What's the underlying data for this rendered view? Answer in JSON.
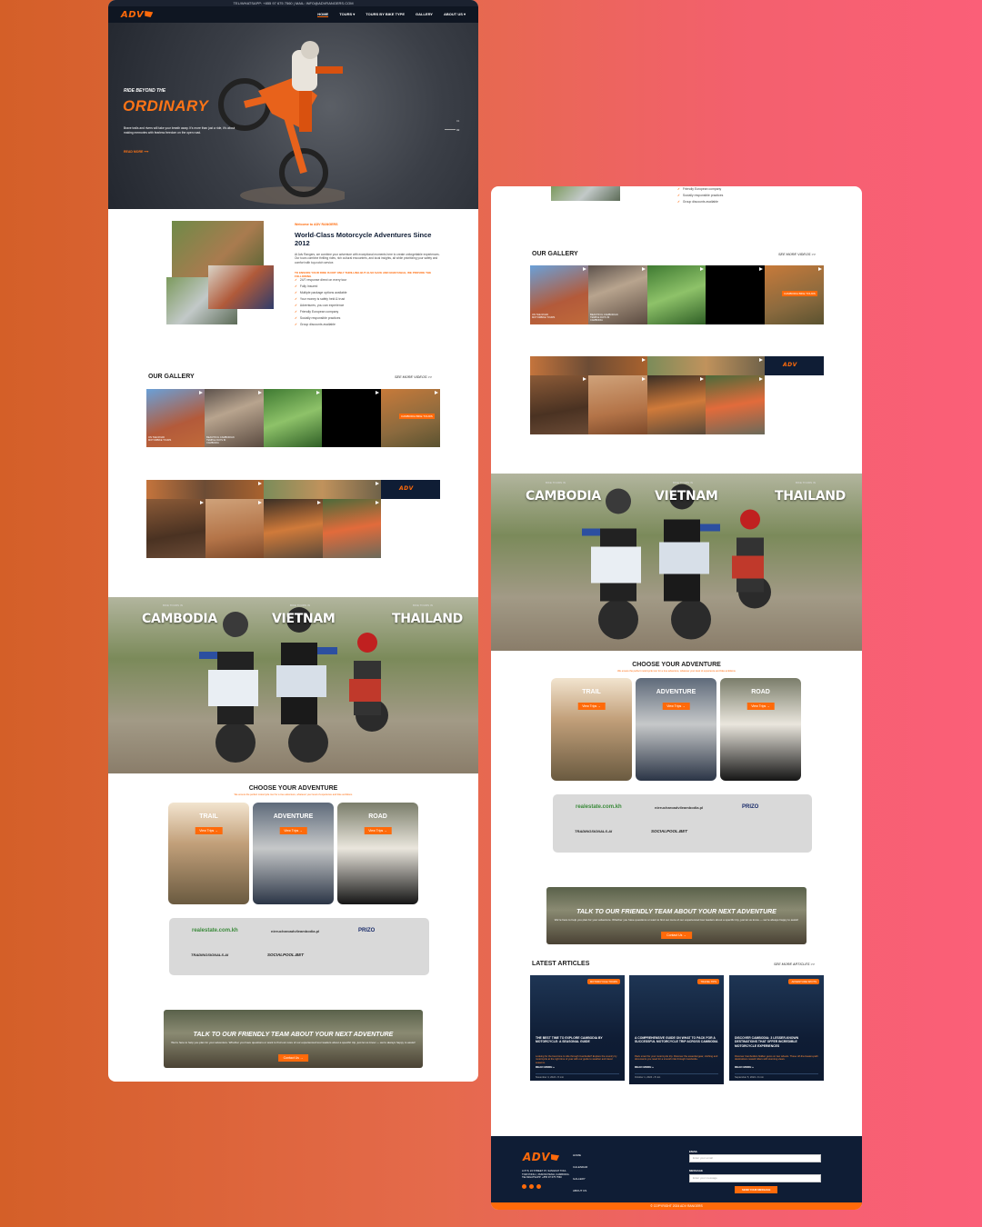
{
  "topbar": {
    "contact": "TEL/WHATSAPP: +855 97 675 7560 | MAIL: INFO@ADVRANGERS.COM"
  },
  "nav": {
    "logo": "ADV",
    "links": [
      "HOME",
      "TOURS ▾",
      "TOURS BY BIKE TYPE",
      "GALLERY",
      "ABOUT US ▾"
    ]
  },
  "hero": {
    "kicker": "RIDE BEYOND THE",
    "title": "ORDINARY",
    "body": "Brave trails and rivers will take your breath away. It's more than just a ride, it's about making memories with fearless freedom on the open road.",
    "button": "READ MORE",
    "social": [
      "FACEBOOK",
      "INSTAGRAM",
      "YOUTUBE"
    ],
    "slider": [
      "01",
      "02"
    ]
  },
  "welcome": {
    "kicker": "Welcome to ADV RANGERS",
    "title": "World-Class Motorcycle Adventures Since 2012",
    "body": "At Adv Rangers, we combine your adventure with exceptional moments here to create unforgettable experiences. Our tours combine thrilling rides, rich cultural encounters, and local insights, all while prioritizing your safety and comfort with top-notch service.",
    "highlight": "TO ENSURE YOUR RIDE IS NOT ONLY THRILLING BUT ALSO SAFE AND ENJOYABLE, WE PROVIDE THE FOLLOWING",
    "checks": [
      "24/7 response direct on every tour",
      "Fully Insured",
      "Multiple package options available",
      "Your money is safely held & trust",
      "Adventures, you can experience",
      "Friendly European company",
      "Socially responsible practices",
      "Group discounts available"
    ],
    "checks_b": [
      "Friendly European company",
      "Socially responsible practices",
      "Group discounts available"
    ]
  },
  "gallery": {
    "title": "OUR GALLERY",
    "see_more": "SEE MORE VIDEOS >>",
    "tile_labels": [
      "ON THE ROAD MOTORBIKE TOURS",
      "BEAUTIFUL CAMBODIAN TEMPLE DAYS IN CAMBODIA",
      "CAMBODIA BIKE TOURS"
    ]
  },
  "countries": {
    "names": [
      "CAMBODIA",
      "VIETNAM",
      "THAILAND"
    ],
    "subs": [
      "BIKE TOURS IN",
      "BIKE TOURS IN",
      "BIKE TOURS IN"
    ]
  },
  "adventure": {
    "title": "CHOOSE YOUR ADVENTURE",
    "subtitle": "We ensure the perfect motorcycle tour for a true adventure, whatever your level of experience and bike ambitions",
    "cards": [
      {
        "label": "TRAIL",
        "button": "View Trips →"
      },
      {
        "label": "ADVENTURE",
        "button": "View Trips →"
      },
      {
        "label": "ROAD",
        "button": "View Trips →"
      }
    ]
  },
  "partners": [
    "realestate.com.kh",
    "nierucharoadvileambodia.pl",
    "PRIZO",
    "TRADINGSIGNALS.AI",
    "SOCIALPOOL.BET"
  ],
  "cta": {
    "title": "TALK TO OUR FRIENDLY TEAM ABOUT YOUR NEXT ADVENTURE",
    "body": "We're here to help you plan for your adventure. Whether you have questions or want to find out more of our experienced tour leaders about a specific trip, just let us know — we're always happy to assist!",
    "button": "Contact Us →"
  },
  "articles": {
    "title": "LATEST ARTICLES",
    "see_more": "SEE MORE ARTICLES >>",
    "items": [
      {
        "badge": "MOTORCYCLE TOURS",
        "title": "THE BEST TIME TO EXPLORE CAMBODIA BY MOTORCYCLE: A SEASONAL GUIDE",
        "body": "Looking for the best time to ride through Cambodia? Explore the country by motorcycle at the right time of year with our guide to weather and travel seasons.",
        "read": "READ MORE »",
        "date": "November 4, 2024 • 5 min"
      },
      {
        "badge": "TRAVEL TIPS",
        "title": "A COMPREHENSIVE GUIDE ON WHAT TO PACK FOR A SUCCESSFUL MOTORCYCLE TRIP ACROSS CAMBODIA",
        "body": "Pack smart for your motorcycle trip. Discover the essential gear, clothing and documents you need for a smooth ride through Cambodia.",
        "read": "READ MORE »",
        "date": "October 1, 2024 • 8 min"
      },
      {
        "badge": "ADVENTURE SPOTS",
        "title": "DISCOVER CAMBODIA: 3 LESSER-KNOWN DESTINATIONS THAT OFFER INCREDIBLE MOTORCYCLE EXPERIENCES",
        "body": "Discover Cambodia's hidden gems on two wheels. These off-the-beaten-path destinations reward riders with stunning views.",
        "read": "READ MORE »",
        "date": "September 5, 2024 • 6 min"
      }
    ]
  },
  "footer": {
    "address": "LOT 8, 24 STREET 97, SANGKAT TOUL TOM PONG I, PHNOM PENH, CAMBODIA. TEL/WHATSAPP: +855 97 675 7560",
    "links": [
      "HOME",
      "CALENDAR",
      "GALLERY",
      "ABOUT US"
    ],
    "email_label": "EMAIL",
    "email_placeholder": "Enter your email",
    "message_label": "MESSAGE",
    "message_placeholder": "Enter your message",
    "submit": "SEND YOUR MESSAGE",
    "copyright": "© COPYRIGHT 2024 ADV RANGERS"
  },
  "colors": {
    "accent": "#ff6a0a",
    "navy": "#0f1d35",
    "background_left": "#d45f28",
    "background_right": "#fb5f78"
  }
}
